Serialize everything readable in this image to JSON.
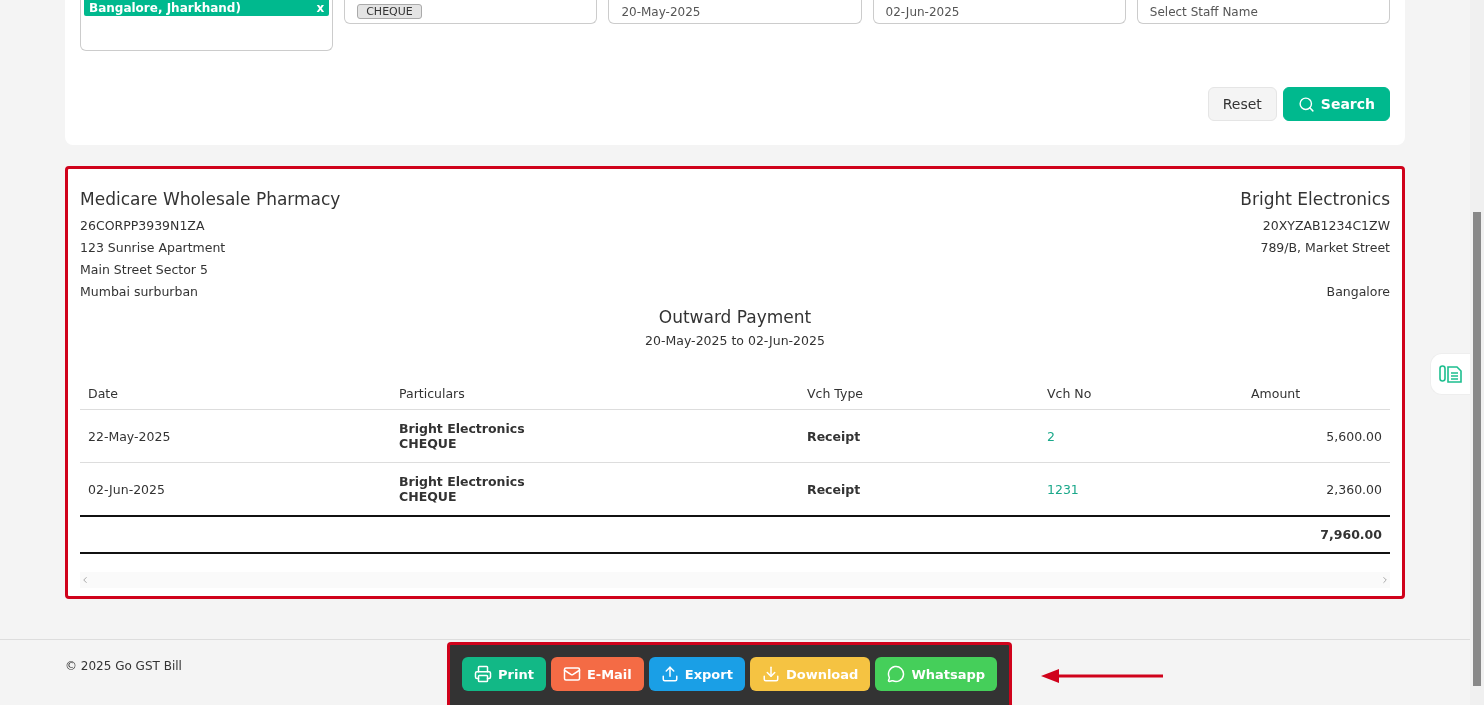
{
  "filters": {
    "location_tag": {
      "label": "Bangalore, Jharkhand)",
      "remove": "x"
    },
    "payment_mode_chip": "CHEQUE",
    "from_date": "20-May-2025",
    "to_date": "02-Jun-2025",
    "staff": {
      "placeholder": "Select Staff Name"
    }
  },
  "filter_buttons": [
    {
      "label": "Reset",
      "kind": "reset"
    },
    {
      "label": "Search",
      "kind": "search"
    }
  ],
  "report": {
    "company": {
      "name": "Medicare Wholesale Pharmacy",
      "lines": [
        "26CORPP3939N1ZA",
        "123 Sunrise Apartment",
        "Main Street Sector 5",
        "Mumbai surburban"
      ]
    },
    "party": {
      "name": "Bright Electronics",
      "lines": [
        "20XYZAB1234C1ZW",
        "789/B, Market Street"
      ],
      "city": "Bangalore"
    },
    "title": "Outward Payment",
    "period": "20-May-2025 to 02-Jun-2025",
    "table": {
      "columns": [
        "Date",
        "Particulars",
        "Vch Type",
        "Vch No",
        "Amount"
      ],
      "rows": [
        {
          "date": "22-May-2025",
          "particulars": [
            "Bright Electronics",
            "CHEQUE"
          ],
          "vch_type": "Receipt",
          "vch_no": "2",
          "amount": "5,600.00"
        },
        {
          "date": "02-Jun-2025",
          "particulars": [
            "Bright Electronics",
            "CHEQUE"
          ],
          "vch_type": "Receipt",
          "vch_no": "1231",
          "amount": "2,360.00"
        }
      ],
      "total": "7,960.00"
    }
  },
  "footer": {
    "copyright": "© 2025 Go GST Bill"
  },
  "actions": [
    {
      "label": "Print",
      "kind": "print"
    },
    {
      "label": "E-Mail",
      "kind": "email"
    },
    {
      "label": "Export",
      "kind": "export"
    },
    {
      "label": "Download",
      "kind": "download"
    },
    {
      "label": "Whatsapp",
      "kind": "whatsapp"
    }
  ]
}
